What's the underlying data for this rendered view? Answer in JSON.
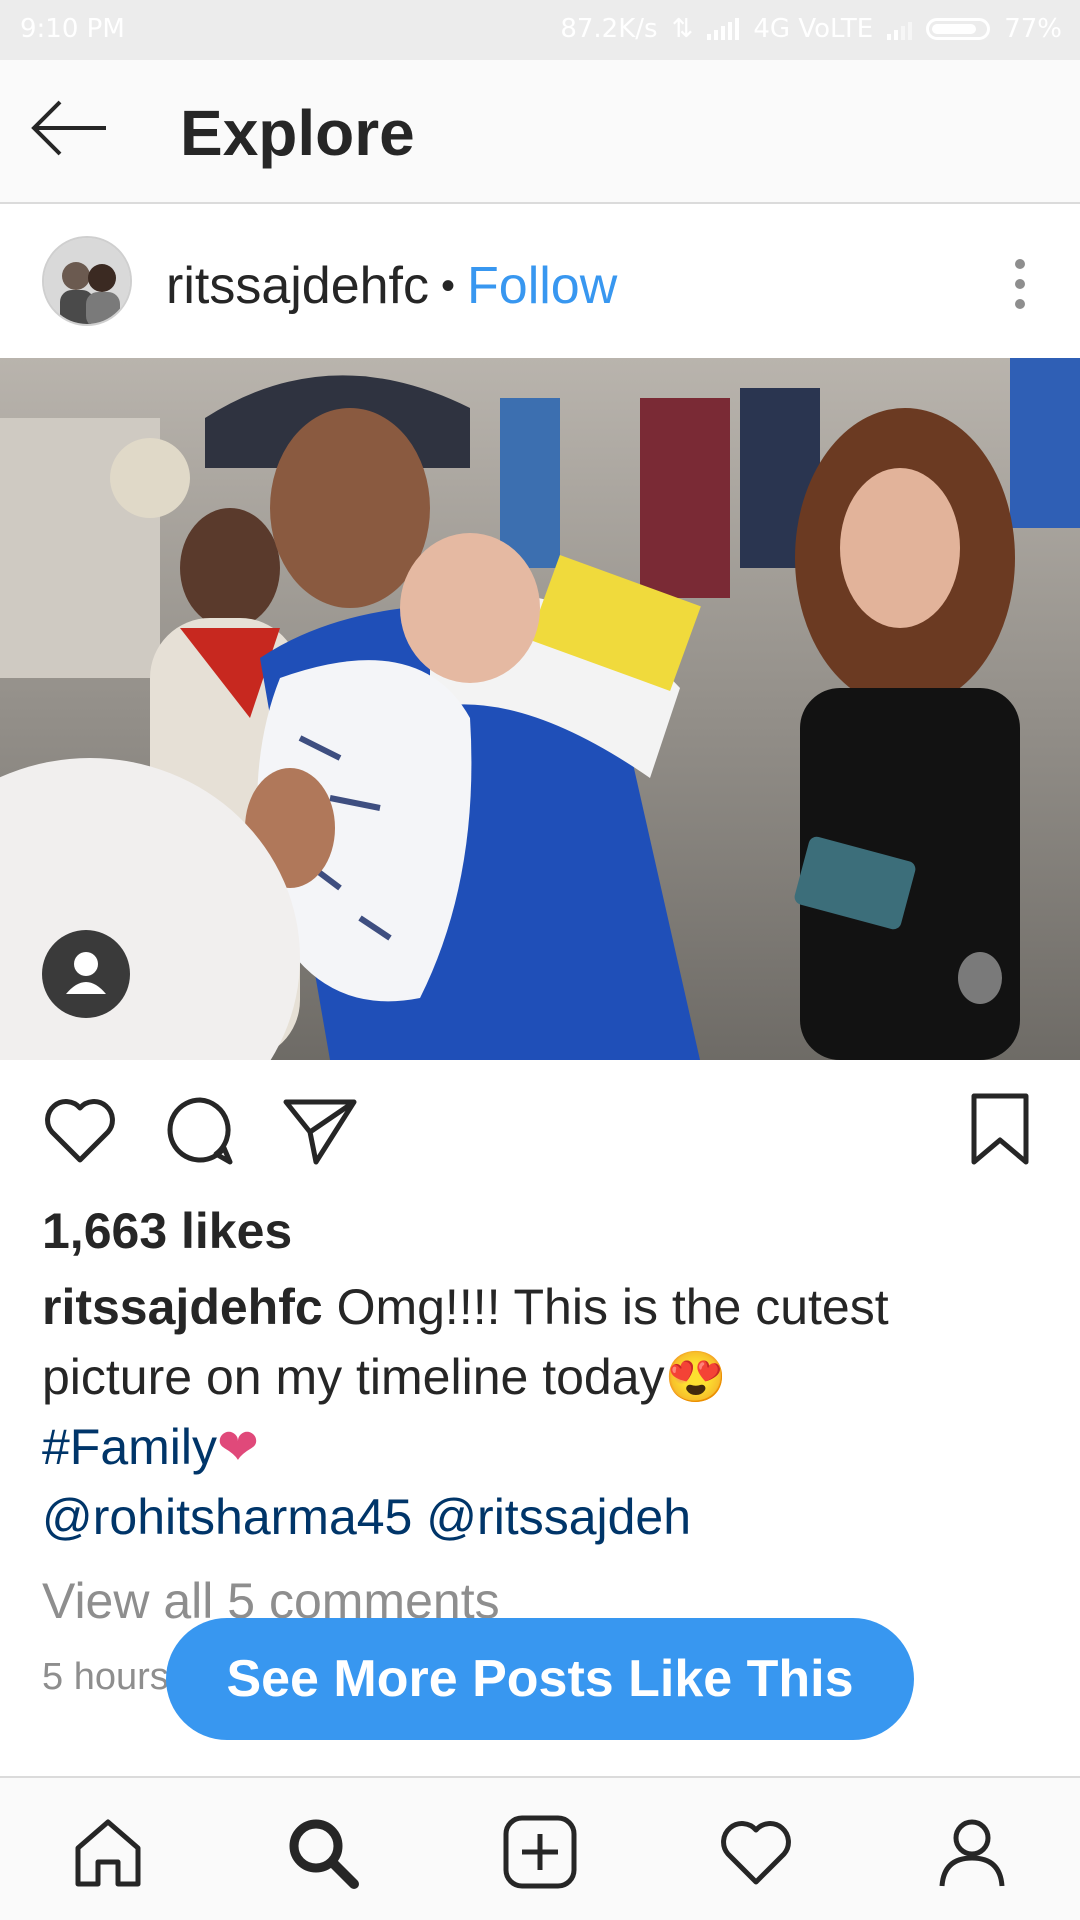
{
  "status_bar": {
    "time": "9:10 PM",
    "speed": "87.2K/s",
    "network": "4G VoLTE",
    "battery": "77%"
  },
  "header": {
    "title": "Explore",
    "back_icon": "arrow-left-icon"
  },
  "post": {
    "username": "ritssajdehfc",
    "separator": "•",
    "follow_label": "Follow",
    "more_icon": "more-vertical-icon",
    "likes": "1,663 likes",
    "caption_username": "ritssajdehfc",
    "caption_text": "Omg!!!! This is the cutest picture on my timeline today",
    "caption_emoji": "😍",
    "hashtag": "#Family",
    "heart_emoji": "❤",
    "mentions": [
      "@rohitsharma45",
      "@ritssajdeh"
    ],
    "view_comments": "View all 5 comments",
    "timestamp": "5 hours"
  },
  "cta": {
    "label": "See More Posts Like This"
  },
  "colors": {
    "accent": "#3897f0",
    "link": "#003569",
    "muted": "#8e8e8e",
    "text": "#262626"
  },
  "tab_bar": {
    "items": [
      "home-icon",
      "search-icon",
      "add-icon",
      "heart-icon",
      "profile-icon"
    ]
  }
}
